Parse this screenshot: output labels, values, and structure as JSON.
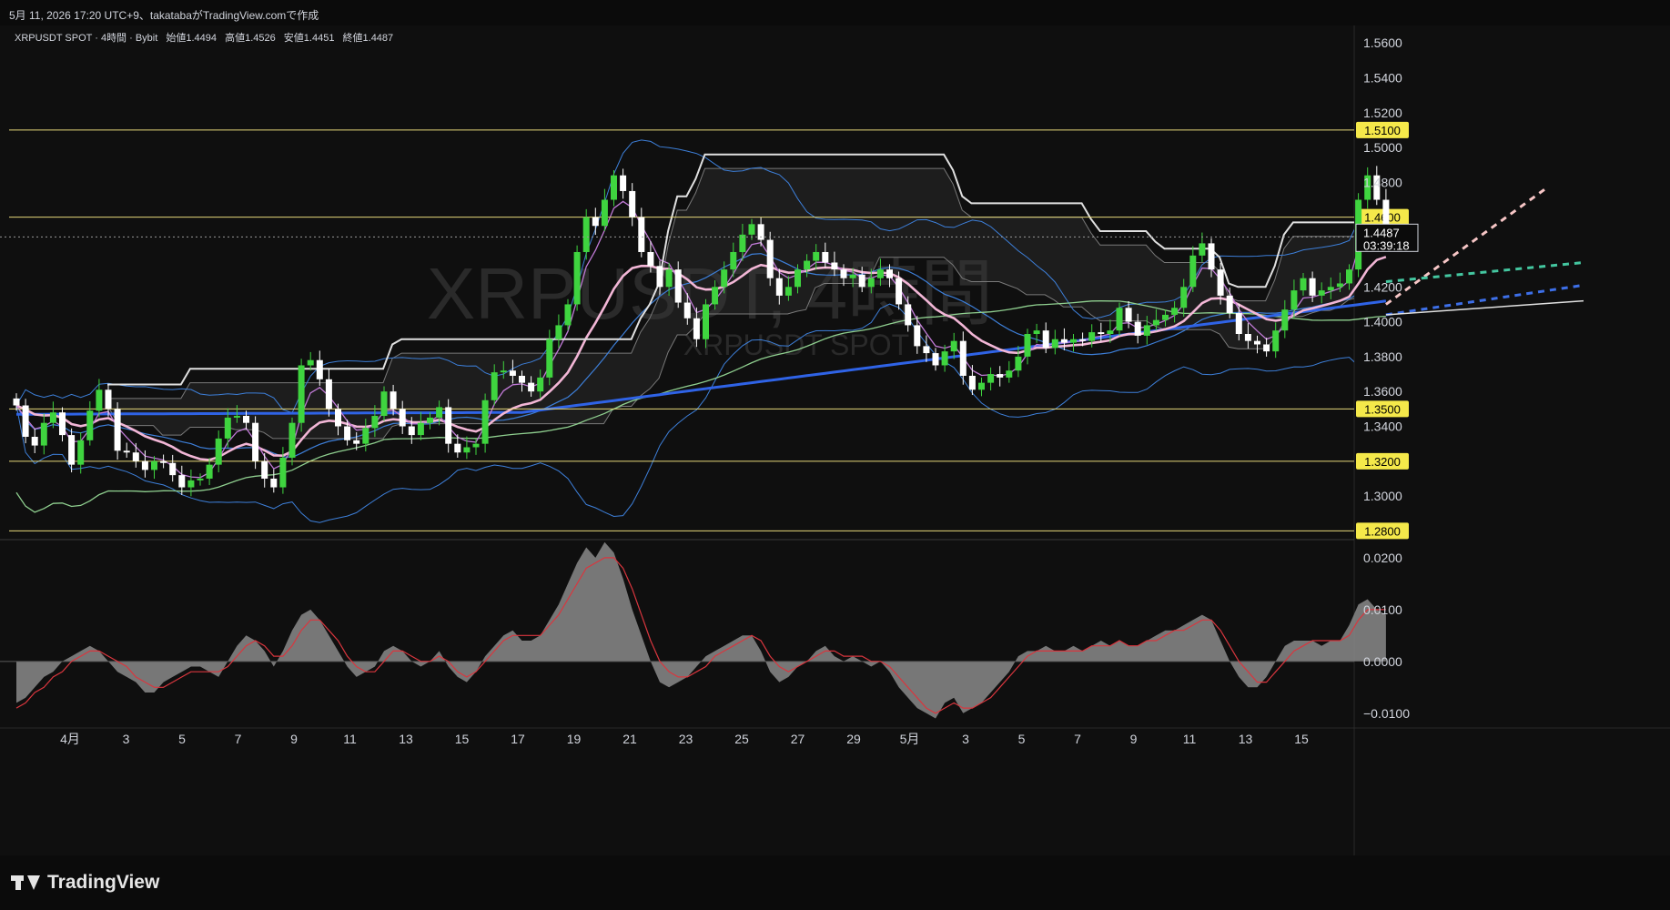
{
  "header": {
    "text": "5月 11, 2026 17:20 UTC+9、takatabaがTradingView.comで作成"
  },
  "chart_info": {
    "symbol_line": "XRPUSDT SPOT · 4時間 · Bybit",
    "open_label": "始値",
    "open_value": "1.4494",
    "high_label": "高値",
    "high_value": "1.4526",
    "low_label": "安値",
    "low_value": "1.4451",
    "close_label": "終値",
    "close_value": "1.4487"
  },
  "watermark": {
    "line1": "XRPUSDT, 4時間",
    "line2": "XRPUSDT SPOT"
  },
  "price_axis": {
    "ticks": [
      "1.5600",
      "1.5400",
      "1.5200",
      "1.5000",
      "1.4800",
      "1.4200",
      "1.4000",
      "1.3800",
      "1.3600",
      "1.3400",
      "1.3000"
    ],
    "current_price": "1.4487",
    "countdown": "03:39:18"
  },
  "levels": [
    "1.5100",
    "1.4600",
    "1.3500",
    "1.3200",
    "1.2800"
  ],
  "osc_axis": {
    "ticks": [
      "0.0200",
      "0.0100",
      "0.0000",
      "−0.0100"
    ]
  },
  "time_axis": {
    "labels": [
      "4月",
      "3",
      "5",
      "7",
      "9",
      "11",
      "13",
      "15",
      "17",
      "19",
      "21",
      "23",
      "25",
      "27",
      "29",
      "5月",
      "3",
      "5",
      "7",
      "9",
      "11",
      "13",
      "15"
    ]
  },
  "colors": {
    "bull": "#3fd43f",
    "bear": "#ffffff",
    "level": "#e6d87a",
    "bb": "#3d7fd9",
    "ema_fast": "#c07ad6",
    "ema_mid": "#f2b6d6",
    "sma200": "#2f63e6",
    "sma_long": "#8fcf8f",
    "donchian": "#e0e0e0",
    "hist": "#8a8a8a",
    "signal": "#d9363e"
  },
  "chart_data": {
    "type": "candlestick",
    "ylim": [
      1.275,
      1.57
    ],
    "osc_ylim": [
      -0.0125,
      0.0235
    ],
    "horizontal_levels": [
      1.51,
      1.46,
      1.35,
      1.32,
      1.28
    ],
    "last_close": 1.4487,
    "series": [
      {
        "name": "close",
        "values": [
          1.352,
          1.334,
          1.329,
          1.342,
          1.348,
          1.335,
          1.318,
          1.332,
          1.349,
          1.361,
          1.35,
          1.326,
          1.325,
          1.32,
          1.315,
          1.32,
          1.319,
          1.312,
          1.305,
          1.309,
          1.31,
          1.318,
          1.333,
          1.345,
          1.346,
          1.342,
          1.32,
          1.31,
          1.305,
          1.322,
          1.342,
          1.375,
          1.378,
          1.367,
          1.35,
          1.34,
          1.332,
          1.33,
          1.339,
          1.346,
          1.36,
          1.35,
          1.34,
          1.335,
          1.342,
          1.345,
          1.351,
          1.33,
          1.325,
          1.328,
          1.33,
          1.355,
          1.371,
          1.372,
          1.369,
          1.365,
          1.36,
          1.368,
          1.39,
          1.398,
          1.41,
          1.44,
          1.46,
          1.455,
          1.47,
          1.484,
          1.475,
          1.46,
          1.44,
          1.432,
          1.42,
          1.43,
          1.411,
          1.402,
          1.39,
          1.41,
          1.42,
          1.43,
          1.44,
          1.45,
          1.456,
          1.447,
          1.425,
          1.415,
          1.42,
          1.43,
          1.435,
          1.44,
          1.434,
          1.43,
          1.425,
          1.427,
          1.42,
          1.425,
          1.43,
          1.425,
          1.41,
          1.398,
          1.386,
          1.382,
          1.375,
          1.383,
          1.389,
          1.369,
          1.361,
          1.365,
          1.37,
          1.368,
          1.372,
          1.38,
          1.393,
          1.395,
          1.385,
          1.39,
          1.388,
          1.39,
          1.389,
          1.394,
          1.393,
          1.395,
          1.408,
          1.4,
          1.392,
          1.398,
          1.401,
          1.404,
          1.408,
          1.42,
          1.438,
          1.445,
          1.43,
          1.415,
          1.405,
          1.393,
          1.389,
          1.387,
          1.383,
          1.395,
          1.407,
          1.418,
          1.425,
          1.415,
          1.418,
          1.42,
          1.422,
          1.43,
          1.47,
          1.484,
          1.47,
          1.4487
        ]
      }
    ],
    "oscillator": {
      "name": "histogram",
      "values": [
        -0.008,
        -0.007,
        -0.005,
        -0.003,
        -0.002,
        0,
        0.001,
        0.002,
        0.003,
        0.002,
        0,
        -0.002,
        -0.003,
        -0.004,
        -0.006,
        -0.006,
        -0.004,
        -0.003,
        -0.002,
        -0.001,
        -0.001,
        -0.002,
        -0.003,
        0,
        0.003,
        0.005,
        0.004,
        0.002,
        -0.001,
        0.002,
        0.006,
        0.009,
        0.01,
        0.008,
        0.005,
        0.002,
        -0.001,
        -0.003,
        -0.002,
        -0.001,
        0.002,
        0.003,
        0.002,
        0,
        -0.001,
        0,
        0.002,
        -0.001,
        -0.003,
        -0.004,
        -0.002,
        0.001,
        0.003,
        0.005,
        0.006,
        0.004,
        0.004,
        0.005,
        0.008,
        0.011,
        0.015,
        0.019,
        0.022,
        0.02,
        0.023,
        0.021,
        0.016,
        0.01,
        0.005,
        0,
        -0.004,
        -0.005,
        -0.004,
        -0.003,
        -0.001,
        0.001,
        0.002,
        0.003,
        0.004,
        0.005,
        0.005,
        0.002,
        -0.002,
        -0.004,
        -0.003,
        -0.001,
        0,
        0.002,
        0.003,
        0.001,
        0,
        0.001,
        0,
        -0.001,
        0,
        -0.002,
        -0.005,
        -0.007,
        -0.009,
        -0.01,
        -0.011,
        -0.008,
        -0.007,
        -0.01,
        -0.009,
        -0.008,
        -0.006,
        -0.004,
        -0.002,
        0.001,
        0.002,
        0.002,
        0.003,
        0.002,
        0.002,
        0.003,
        0.002,
        0.003,
        0.004,
        0.003,
        0.004,
        0.003,
        0.003,
        0.004,
        0.005,
        0.006,
        0.006,
        0.007,
        0.008,
        0.009,
        0.008,
        0.004,
        0,
        -0.003,
        -0.005,
        -0.005,
        -0.003,
        0,
        0.003,
        0.004,
        0.004,
        0.004,
        0.003,
        0.004,
        0.004,
        0.007,
        0.011,
        0.012,
        0.01,
        0.009
      ]
    },
    "signal_line": {
      "name": "signal",
      "values": [
        -0.009,
        -0.008,
        -0.006,
        -0.005,
        -0.003,
        -0.002,
        0,
        0.001,
        0.002,
        0.002,
        0.001,
        0,
        -0.001,
        -0.003,
        -0.004,
        -0.005,
        -0.005,
        -0.004,
        -0.003,
        -0.002,
        -0.002,
        -0.002,
        -0.002,
        -0.001,
        0.001,
        0.003,
        0.004,
        0.003,
        0.001,
        0.001,
        0.003,
        0.006,
        0.008,
        0.008,
        0.006,
        0.004,
        0.001,
        -0.001,
        -0.002,
        -0.002,
        0,
        0.002,
        0.002,
        0.001,
        0,
        0,
        0.001,
        0,
        -0.002,
        -0.003,
        -0.002,
        0,
        0.002,
        0.004,
        0.005,
        0.005,
        0.005,
        0.005,
        0.007,
        0.009,
        0.012,
        0.015,
        0.018,
        0.019,
        0.02,
        0.02,
        0.018,
        0.014,
        0.009,
        0.004,
        0,
        -0.002,
        -0.003,
        -0.003,
        -0.002,
        -0.001,
        0.001,
        0.002,
        0.003,
        0.004,
        0.005,
        0.004,
        0.001,
        -0.001,
        -0.002,
        -0.001,
        0,
        0.001,
        0.002,
        0.002,
        0.001,
        0.001,
        0.001,
        0,
        0,
        -0.001,
        -0.003,
        -0.005,
        -0.007,
        -0.009,
        -0.01,
        -0.009,
        -0.008,
        -0.009,
        -0.009,
        -0.008,
        -0.007,
        -0.005,
        -0.003,
        -0.001,
        0.001,
        0.002,
        0.002,
        0.002,
        0.002,
        0.002,
        0.002,
        0.003,
        0.003,
        0.003,
        0.004,
        0.003,
        0.003,
        0.004,
        0.004,
        0.005,
        0.006,
        0.006,
        0.007,
        0.008,
        0.008,
        0.006,
        0.003,
        0,
        -0.002,
        -0.004,
        -0.004,
        -0.002,
        0,
        0.002,
        0.003,
        0.004,
        0.004,
        0.004,
        0.004,
        0.005,
        0.008,
        0.01,
        0.01,
        0.01
      ]
    }
  }
}
